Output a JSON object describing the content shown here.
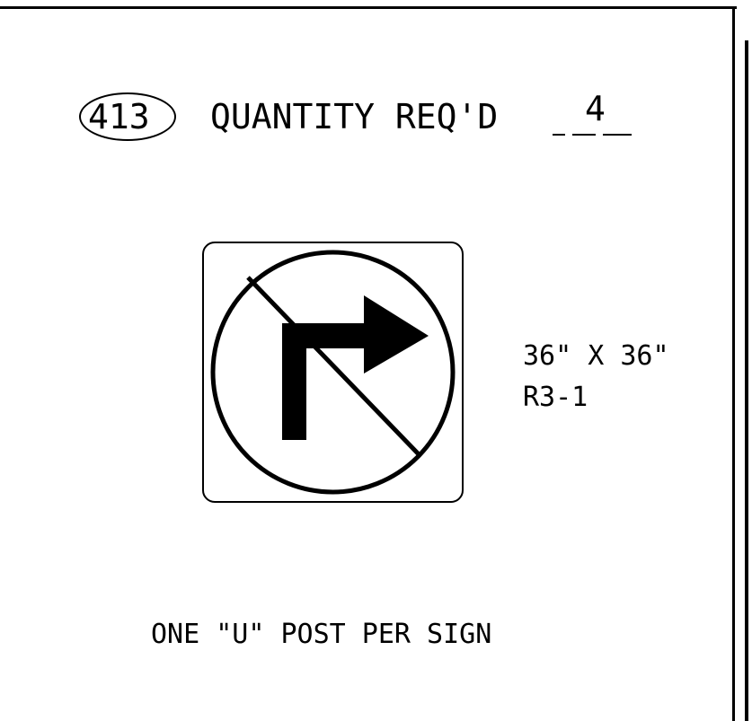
{
  "header": {
    "item_number": "413",
    "quantity_label": "QUANTITY REQ'D",
    "quantity_value": "4"
  },
  "sign": {
    "symbol": "no-right-turn-icon",
    "size": "36\" X 36\"",
    "code": "R3-1"
  },
  "note": "ONE \"U\" POST PER SIGN",
  "colors": {
    "ink": "#000000",
    "paper": "#ffffff"
  }
}
